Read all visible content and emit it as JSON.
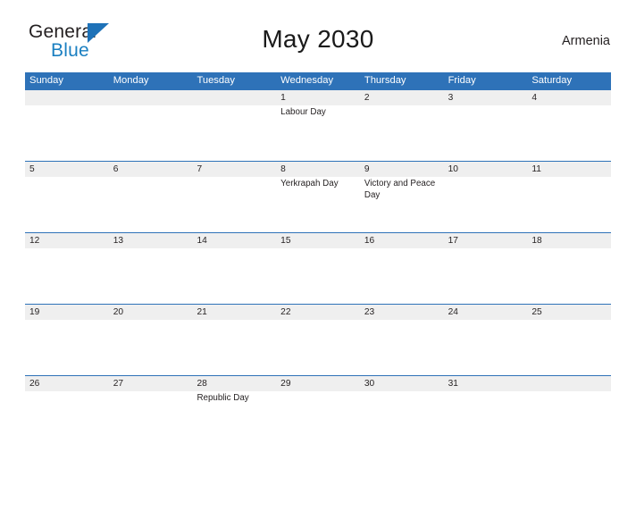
{
  "logo": {
    "word_one": "General",
    "word_two": "Blue",
    "triangle_color": "#1e72b8",
    "blue_text_color": "#1a7fc1"
  },
  "header": {
    "title": "May 2030",
    "country": "Armenia"
  },
  "theme": {
    "header_blue": "#2e72b8",
    "day_band_gray": "#efefef",
    "text_color": "#231f20",
    "page_background": "#ffffff"
  },
  "calendar": {
    "month": "May",
    "year": "2030",
    "weekday_headers": [
      "Sunday",
      "Monday",
      "Tuesday",
      "Wednesday",
      "Thursday",
      "Friday",
      "Saturday"
    ],
    "weeks": [
      {
        "days": [
          {
            "date": "",
            "event": ""
          },
          {
            "date": "",
            "event": ""
          },
          {
            "date": "",
            "event": ""
          },
          {
            "date": "1",
            "event": "Labour Day"
          },
          {
            "date": "2",
            "event": ""
          },
          {
            "date": "3",
            "event": ""
          },
          {
            "date": "4",
            "event": ""
          }
        ]
      },
      {
        "days": [
          {
            "date": "5",
            "event": ""
          },
          {
            "date": "6",
            "event": ""
          },
          {
            "date": "7",
            "event": ""
          },
          {
            "date": "8",
            "event": "Yerkrapah Day"
          },
          {
            "date": "9",
            "event": "Victory and Peace Day"
          },
          {
            "date": "10",
            "event": ""
          },
          {
            "date": "11",
            "event": ""
          }
        ]
      },
      {
        "days": [
          {
            "date": "12",
            "event": ""
          },
          {
            "date": "13",
            "event": ""
          },
          {
            "date": "14",
            "event": ""
          },
          {
            "date": "15",
            "event": ""
          },
          {
            "date": "16",
            "event": ""
          },
          {
            "date": "17",
            "event": ""
          },
          {
            "date": "18",
            "event": ""
          }
        ]
      },
      {
        "days": [
          {
            "date": "19",
            "event": ""
          },
          {
            "date": "20",
            "event": ""
          },
          {
            "date": "21",
            "event": ""
          },
          {
            "date": "22",
            "event": ""
          },
          {
            "date": "23",
            "event": ""
          },
          {
            "date": "24",
            "event": ""
          },
          {
            "date": "25",
            "event": ""
          }
        ]
      },
      {
        "days": [
          {
            "date": "26",
            "event": ""
          },
          {
            "date": "27",
            "event": ""
          },
          {
            "date": "28",
            "event": "Republic Day"
          },
          {
            "date": "29",
            "event": ""
          },
          {
            "date": "30",
            "event": ""
          },
          {
            "date": "31",
            "event": ""
          },
          {
            "date": "",
            "event": ""
          }
        ]
      }
    ]
  }
}
